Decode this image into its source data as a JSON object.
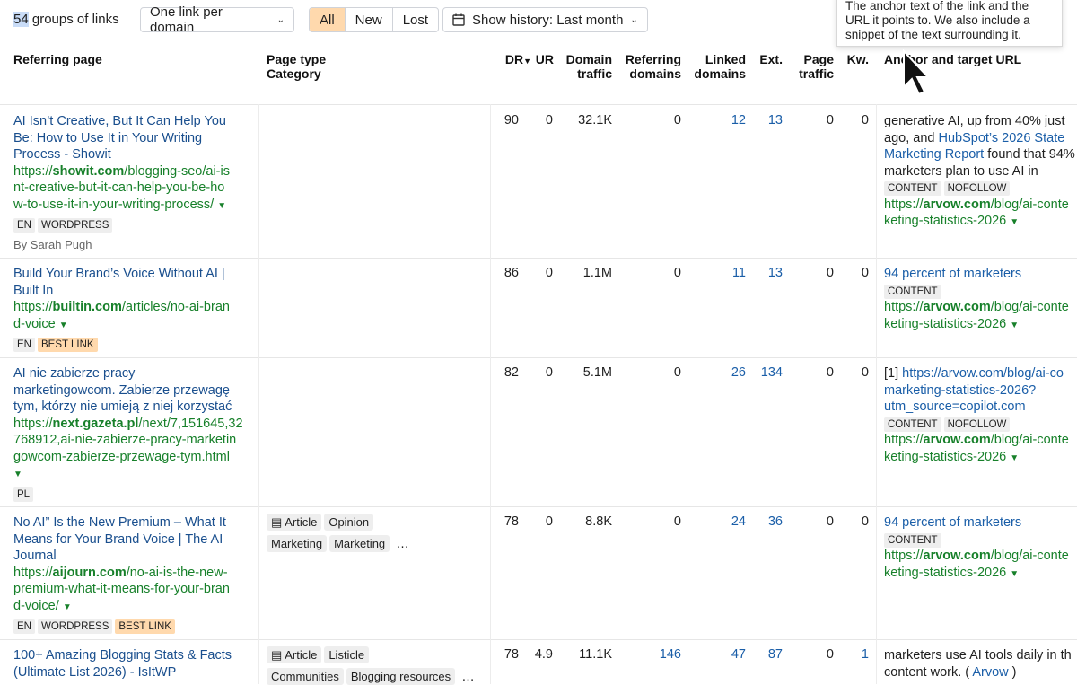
{
  "toolbar": {
    "groups_count": "54",
    "groups_label": " groups of links",
    "link_mode": "One link per domain",
    "filters": [
      "All",
      "New",
      "Lost"
    ],
    "history": "Show history: Last month"
  },
  "tooltip": "The anchor text of the link and the URL it points to. We also include a snippet of the text surrounding it.",
  "columns": {
    "referring_page": "Referring page",
    "page_type": "Page type",
    "category": "Category",
    "dr": "DR",
    "ur": "UR",
    "domain_traffic": [
      "Domain",
      "traffic"
    ],
    "referring_domains": [
      "Referring",
      "domains"
    ],
    "linked_domains": [
      "Linked",
      "domains"
    ],
    "ext": "Ext.",
    "page_traffic": [
      "Page",
      "traffic"
    ],
    "kw": "Kw.",
    "anchor": "Anchor and target URL"
  },
  "rows": [
    {
      "title": [
        "AI Isn’t Creative, But It Can Help You",
        "Be: How to Use It in Your Writing",
        "Process - Showit"
      ],
      "url_prefix": "https://",
      "url_domain": "showit.com",
      "url_rest": [
        "/blogging-seo/ai-is",
        "nt-creative-but-it-can-help-you-be-ho",
        "w-to-use-it-in-your-writing-process/"
      ],
      "tags": [
        "EN",
        "WORDPRESS"
      ],
      "author": "By Sarah Pugh",
      "dr": "90",
      "ur": "0",
      "domain_traffic": "32.1K",
      "referring_domains": "0",
      "linked_domains": "12",
      "ext": "13",
      "page_traffic": "0",
      "kw": "0",
      "anchor_lines": [
        "generative AI, up from 40% just",
        "ago, and ",
        "HubSpot’s 2026 State",
        "Marketing Report",
        " found that 94%",
        "marketers plan to use AI in"
      ],
      "anchor_tags": [
        "CONTENT",
        "NOFOLLOW"
      ],
      "target": [
        "https://",
        "arvow.com",
        "/blog/ai-conte",
        "keting-statistics-2026"
      ]
    },
    {
      "title": [
        "Build Your Brand’s Voice Without AI |",
        "Built In"
      ],
      "url_prefix": "https://",
      "url_domain": "builtin.com",
      "url_rest": [
        "/articles/no-ai-bran",
        "d-voice"
      ],
      "tags": [
        "EN",
        "BEST LINK"
      ],
      "dr": "86",
      "ur": "0",
      "domain_traffic": "1.1M",
      "referring_domains": "0",
      "linked_domains": "11",
      "ext": "13",
      "page_traffic": "0",
      "kw": "0",
      "anchor_text": "94 percent of marketers",
      "anchor_tags": [
        "CONTENT"
      ],
      "target": [
        "https://",
        "arvow.com",
        "/blog/ai-conte",
        "keting-statistics-2026"
      ]
    },
    {
      "title": [
        "AI nie zabierze pracy",
        "marketingowcom. Zabierze przewagę",
        "tym, którzy nie umieją z niej korzystać"
      ],
      "url_prefix": "https://",
      "url_domain": "next.gazeta.pl",
      "url_rest": [
        "/next/7,151645,32",
        "768912,ai-nie-zabierze-pracy-marketin",
        "gowcom-zabierze-przewage-tym.html"
      ],
      "tags": [
        "PL"
      ],
      "dr": "82",
      "ur": "0",
      "domain_traffic": "5.1M",
      "referring_domains": "0",
      "linked_domains": "26",
      "ext": "134",
      "page_traffic": "0",
      "kw": "0",
      "anchor_lines": [
        "[1] ",
        "https://arvow.com/blog/ai-co",
        "marketing-statistics-2026?",
        "utm_source=copilot.com"
      ],
      "anchor_tags": [
        "CONTENT",
        "NOFOLLOW"
      ],
      "target": [
        "https://",
        "arvow.com",
        "/blog/ai-conte",
        "keting-statistics-2026"
      ]
    },
    {
      "title": [
        "No AI” Is the New Premium – What It",
        "Means for Your Brand Voice | The AI",
        "Journal"
      ],
      "url_prefix": "https://",
      "url_domain": "aijourn.com",
      "url_rest": [
        "/no-ai-is-the-new-",
        "premium-what-it-means-for-your-bran",
        "d-voice/"
      ],
      "tags": [
        "EN",
        "WORDPRESS",
        "BEST LINK"
      ],
      "page_type": [
        "Article",
        "Opinion"
      ],
      "categories": [
        "Marketing",
        "Marketing"
      ],
      "more": "…",
      "dr": "78",
      "ur": "0",
      "domain_traffic": "8.8K",
      "referring_domains": "0",
      "linked_domains": "24",
      "ext": "36",
      "page_traffic": "0",
      "kw": "0",
      "anchor_text": "94 percent of marketers",
      "anchor_tags": [
        "CONTENT"
      ],
      "target": [
        "https://",
        "arvow.com",
        "/blog/ai-conte",
        "keting-statistics-2026"
      ]
    },
    {
      "title": [
        "100+ Amazing Blogging Stats & Facts",
        "(Ultimate List 2026) - IsItWP"
      ],
      "page_type": [
        "Article",
        "Listicle"
      ],
      "categories": [
        "Communities",
        "Blogging resources"
      ],
      "more": "…",
      "dr": "78",
      "ur": "4.9",
      "domain_traffic": "11.1K",
      "referring_domains": "146",
      "linked_domains": "47",
      "ext": "87",
      "page_traffic": "0",
      "kw": "1",
      "anchor_lines": [
        "marketers use AI tools daily in th",
        "content work. ( ",
        "Arvow",
        " )"
      ]
    }
  ],
  "colors": {
    "accent": "#ffd9ad",
    "link": "#1a5ea8",
    "url": "#17802a"
  }
}
